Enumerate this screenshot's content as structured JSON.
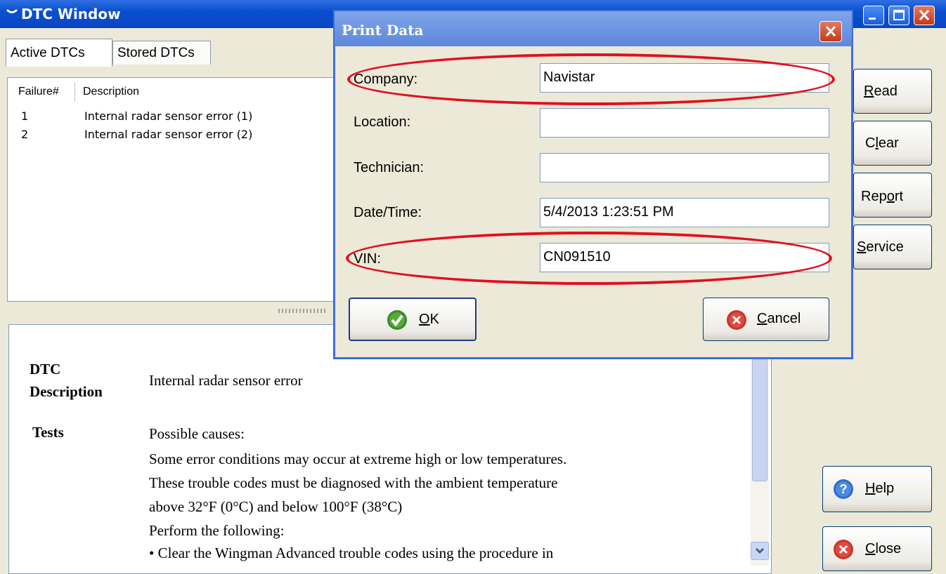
{
  "window": {
    "title": "DTC Window"
  },
  "tabs": [
    {
      "label": "Active DTCs"
    },
    {
      "label": "Stored DTCs"
    }
  ],
  "dtc_list": {
    "columns": [
      "Failure#",
      "Description"
    ],
    "rows": [
      {
        "num": "1",
        "desc": "Internal radar sensor error (1)"
      },
      {
        "num": "2",
        "desc": "Internal radar sensor error (2)"
      }
    ]
  },
  "details": {
    "desc_heading_1": "DTC",
    "desc_heading_2": "Description",
    "desc_value": "Internal radar sensor error",
    "tests_heading": "Tests",
    "lines": [
      "Possible causes:",
      "Some error conditions may occur at extreme high or low temperatures.",
      "These trouble codes must be diagnosed with the ambient temperature",
      "above 32°F (0°C) and below 100°F (38°C)",
      "Perform the following:",
      "• Clear the Wingman Advanced trouble codes using the procedure in"
    ]
  },
  "side_buttons": {
    "read": {
      "pre": "",
      "mn": "R",
      "post": "ead"
    },
    "clear": {
      "pre": "C",
      "mn": "l",
      "post": "ear"
    },
    "report": {
      "pre": "Rep",
      "mn": "o",
      "post": "rt"
    },
    "service": {
      "pre": "",
      "mn": "S",
      "post": "ervice"
    },
    "help": {
      "pre": "",
      "mn": "H",
      "post": "elp"
    },
    "close": {
      "pre": "",
      "mn": "C",
      "post": "lose"
    }
  },
  "dialog": {
    "title": "Print Data",
    "fields": {
      "company": {
        "label": "Company:",
        "value": "Navistar"
      },
      "location": {
        "label": "Location:",
        "value": ""
      },
      "technician": {
        "label": "Technician:",
        "value": ""
      },
      "datetime": {
        "label": "Date/Time:",
        "value": "5/4/2013 1:23:51 PM"
      },
      "vin": {
        "label": "VIN:",
        "value": "CN091510"
      }
    },
    "ok": {
      "mn": "O",
      "post": "K"
    },
    "cancel": {
      "mn": "C",
      "post": "ancel"
    }
  },
  "annotation_color": "#e01020"
}
